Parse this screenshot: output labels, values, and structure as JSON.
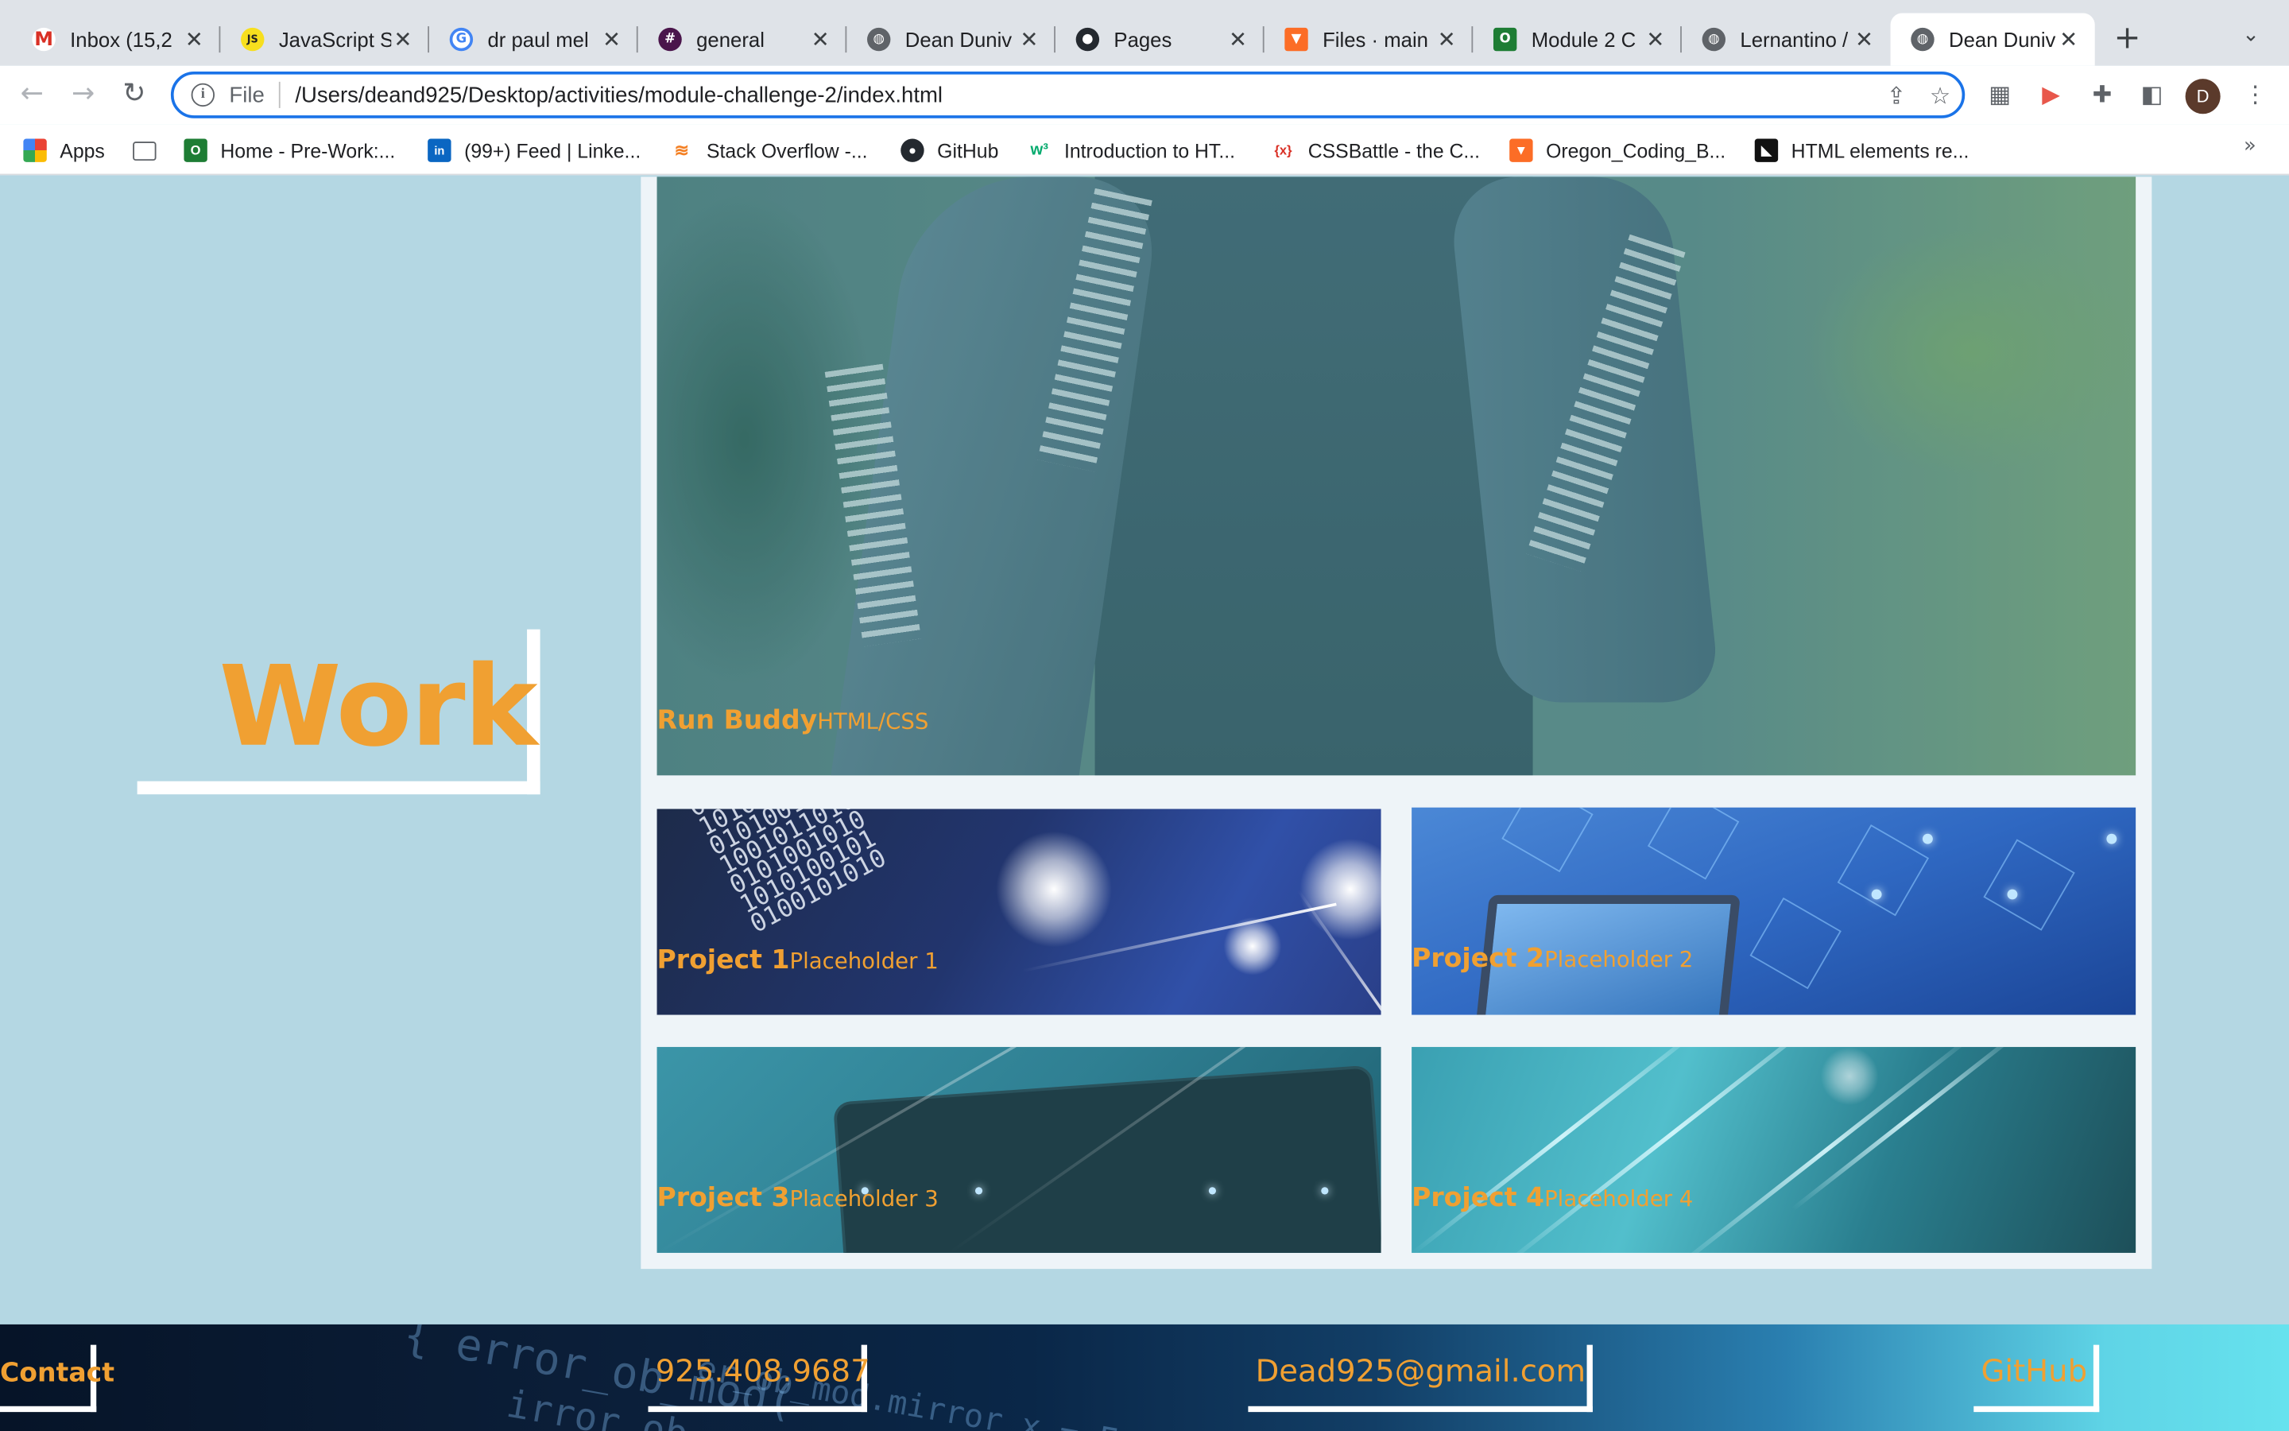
{
  "browser": {
    "tabs": [
      {
        "title": "Inbox (15,2",
        "icon": "gmail-icon",
        "active": false
      },
      {
        "title": "JavaScript S",
        "icon": "javascript-icon",
        "active": false
      },
      {
        "title": "dr paul mel",
        "icon": "google-icon",
        "active": false
      },
      {
        "title": "general",
        "icon": "slack-icon",
        "active": false
      },
      {
        "title": "Dean Duniv",
        "icon": "globe-icon",
        "active": false
      },
      {
        "title": "Pages",
        "icon": "github-icon",
        "active": false
      },
      {
        "title": "Files · main",
        "icon": "gitlab-icon",
        "active": false
      },
      {
        "title": "Module 2 C",
        "icon": "module-icon",
        "active": false
      },
      {
        "title": "Lernantino /",
        "icon": "globe-icon",
        "active": false
      },
      {
        "title": "Dean Duniv",
        "icon": "globe-icon",
        "active": true
      }
    ],
    "new_tab": "+",
    "address": {
      "scheme_label": "File",
      "url": "/Users/deand925/Desktop/activities/module-challenge-2/index.html"
    },
    "profile_initial": "D",
    "bookmarks": [
      {
        "label": "Apps",
        "icon": "apps-grid-icon"
      },
      {
        "label": "",
        "icon": "folder-icon"
      },
      {
        "label": "Home - Pre-Work:...",
        "icon": "module-icon"
      },
      {
        "label": "(99+) Feed | Linke...",
        "icon": "linkedin-icon"
      },
      {
        "label": "Stack Overflow -...",
        "icon": "stackoverflow-icon"
      },
      {
        "label": "GitHub",
        "icon": "github-icon"
      },
      {
        "label": "Introduction to HT...",
        "icon": "w3-icon"
      },
      {
        "label": "CSSBattle - the C...",
        "icon": "cssbattle-icon"
      },
      {
        "label": "Oregon_Coding_B...",
        "icon": "gitlab-icon"
      },
      {
        "label": "HTML elements re...",
        "icon": "mdn-icon"
      }
    ],
    "bookmarks_overflow": "»"
  },
  "page": {
    "section_title": "Work",
    "featured": {
      "name": "Run Buddy",
      "subtitle": "HTML/CSS"
    },
    "projects": [
      {
        "name": "Project 1",
        "subtitle": "Placeholder 1"
      },
      {
        "name": "Project 2",
        "subtitle": "Placeholder 2"
      },
      {
        "name": "Project 3",
        "subtitle": "Placeholder 3"
      },
      {
        "name": "Project 4",
        "subtitle": "Placeholder 4"
      }
    ],
    "footer": {
      "contact": "Contact",
      "phone": "925.408.9687",
      "email": "Dead925@gmail.com",
      "github": "GitHub"
    }
  },
  "colors": {
    "accent_orange": "#f0a032",
    "page_background": "#b4d7e3",
    "omnibox_focus": "#1a73e8"
  }
}
